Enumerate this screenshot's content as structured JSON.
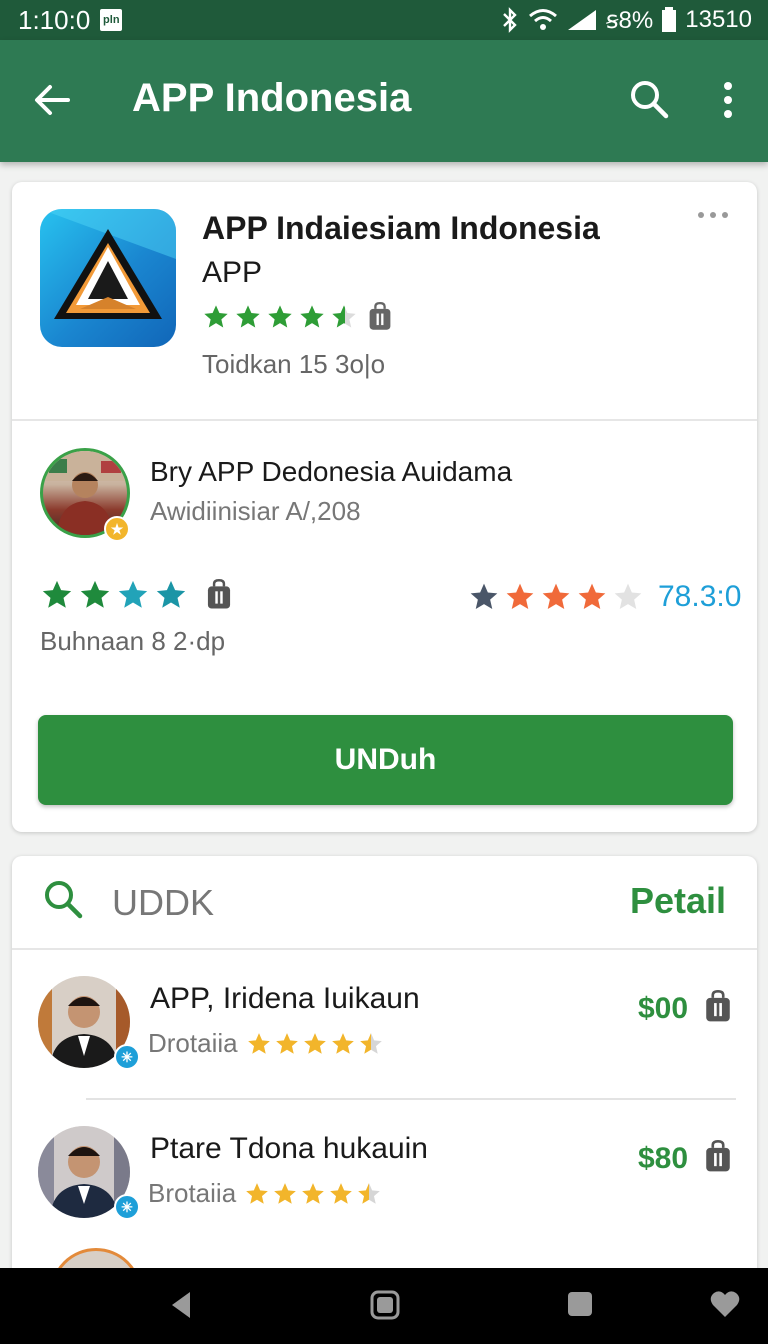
{
  "status_bar": {
    "time": "1:10:0",
    "notification": "pln",
    "battery_text": "ꞩ8%",
    "right_number": "13510"
  },
  "app_bar": {
    "title": "APP Indonesia",
    "back_icon": "arrow-back-icon",
    "search_icon": "search-icon",
    "more_icon": "more-vert-icon",
    "color": "#2e7a53"
  },
  "app_card": {
    "name": "APP Indaiesiam Indonesia",
    "subtitle": "APP",
    "rating_stars": 4.5,
    "downloads": "Toidkan 15 3o|o",
    "developer_name": "Bry APP Dedonesia Auidama",
    "developer_sub": "Awidiinisiar A/,208",
    "left_stars": 4,
    "bottom_text": "Buhnaan 8 2·dp",
    "right_stars": 4,
    "rating_value": "78.3:0",
    "download_label": "UNDuh",
    "accent": "#2e8f3f"
  },
  "list_card": {
    "search_text": "UDDK",
    "action_label": "Petail",
    "items": [
      {
        "title": "APP, Iridena Iuikaun",
        "subtitle": "Drotaiia",
        "stars": 4.5,
        "price": "$00"
      },
      {
        "title": "Ptare Tdona hukauin",
        "subtitle": "Brotaiia",
        "stars": 4.5,
        "price": "$80"
      }
    ]
  },
  "nav_bar": {
    "icons": [
      "back-triangle-icon",
      "home-icon",
      "recents-icon",
      "heart-icon"
    ]
  }
}
